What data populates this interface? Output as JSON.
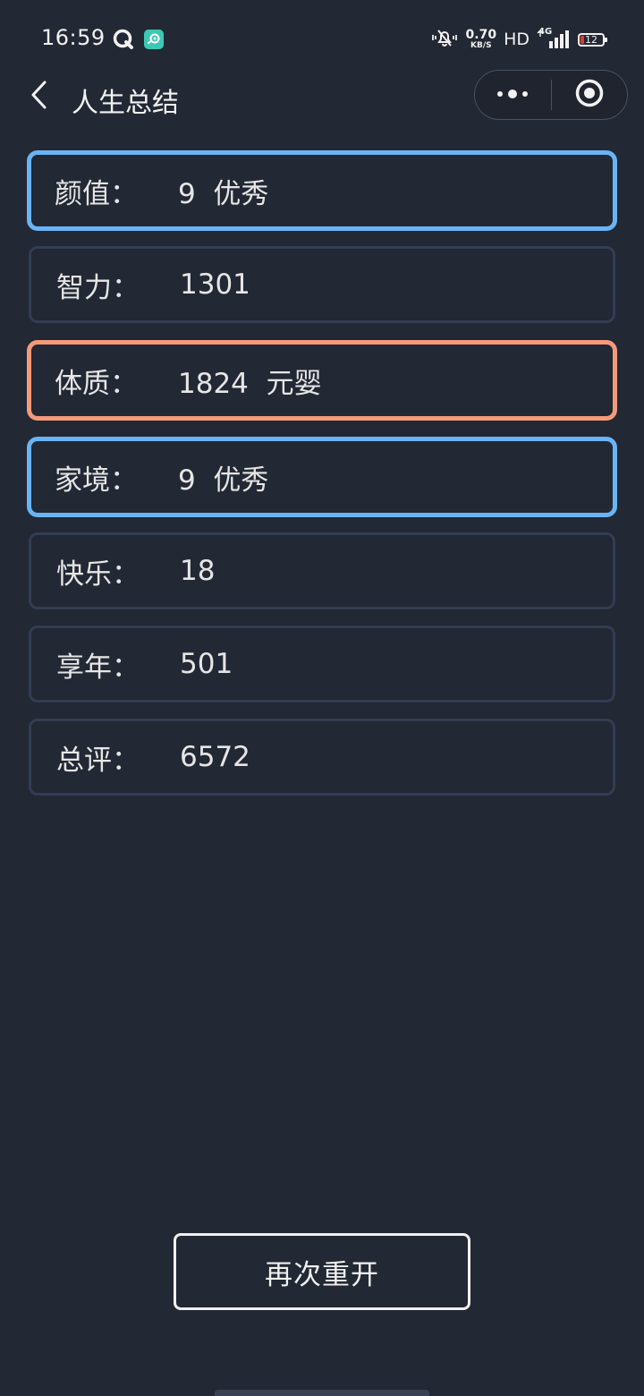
{
  "status_bar": {
    "time": "16:59",
    "net_speed_value": "0.70",
    "net_speed_unit": "KB/S",
    "hd_label": "HD",
    "network_label": "4G",
    "battery_level": "12",
    "icons": [
      "qq-browser-icon",
      "app-notification-icon",
      "mute-bell-icon",
      "signal-icon",
      "battery-icon"
    ]
  },
  "nav": {
    "title": "人生总结",
    "back_icon": "chevron-left-icon",
    "more_icon": "more-dots-icon",
    "close_icon": "target-close-icon"
  },
  "summary": {
    "items": [
      {
        "label": "颜值：",
        "value": "9  优秀",
        "highlight": "blue"
      },
      {
        "label": "智力：",
        "value": "1301",
        "highlight": "none"
      },
      {
        "label": "体质：",
        "value": "1824  元婴",
        "highlight": "orange"
      },
      {
        "label": "家境：",
        "value": "9  优秀",
        "highlight": "blue"
      },
      {
        "label": "快乐：",
        "value": "18",
        "highlight": "none"
      },
      {
        "label": "享年：",
        "value": "501",
        "highlight": "none"
      },
      {
        "label": "总评：",
        "value": "6572",
        "highlight": "none"
      }
    ]
  },
  "actions": {
    "restart_label": "再次重开"
  },
  "colors": {
    "background": "#222834",
    "card_border": "#333d52",
    "highlight_blue": "#6ab4f5",
    "highlight_orange": "#f59a7a",
    "text": "#e6e6e6"
  }
}
